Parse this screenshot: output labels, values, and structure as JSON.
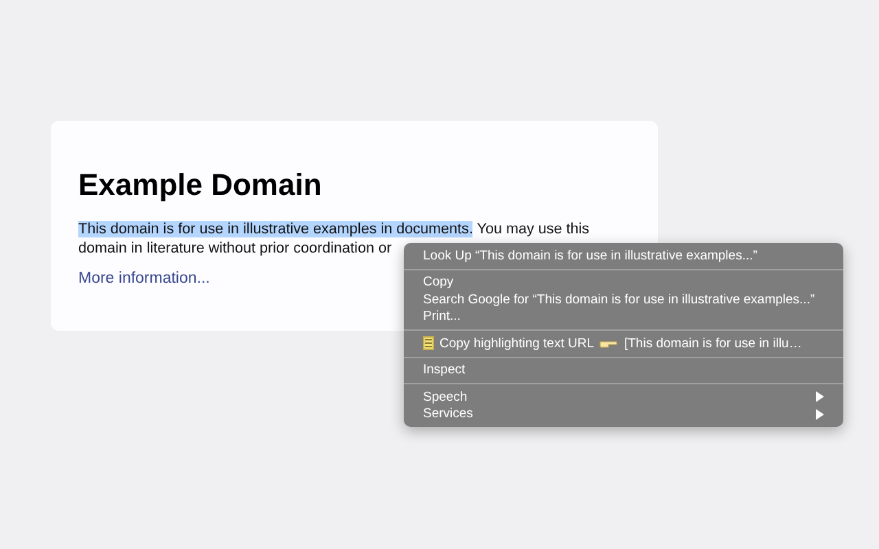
{
  "page": {
    "heading": "Example Domain",
    "paragraph_lines": [
      {
        "parts": [
          {
            "text": "This domain is for use in illustrative examples in documents.",
            "selected": true
          },
          {
            "text": " You may use this",
            "selected": false
          }
        ]
      },
      {
        "parts": [
          {
            "text": "domain in literature without prior coordination or",
            "selected": false
          }
        ]
      }
    ],
    "link": "More information..."
  },
  "context_menu": {
    "sections": [
      [
        {
          "kind": "item",
          "label": "Look Up “This domain is for use in illustrative examples...”",
          "submenu": false
        }
      ],
      [
        {
          "kind": "item",
          "label": "Copy",
          "submenu": false
        },
        {
          "kind": "item",
          "label": "Search Google for “This domain is for use in illustrative examples...”",
          "submenu": false
        },
        {
          "kind": "item",
          "label": "Print...",
          "submenu": false
        }
      ],
      [
        {
          "kind": "extension",
          "label": "Copy highlighting text URL",
          "detail": "[This domain is for use in illu…",
          "submenu": false
        }
      ],
      [
        {
          "kind": "item",
          "label": "Inspect",
          "submenu": false
        }
      ],
      [
        {
          "kind": "item",
          "label": "Speech",
          "submenu": true
        },
        {
          "kind": "item",
          "label": "Services",
          "submenu": true
        }
      ]
    ]
  }
}
